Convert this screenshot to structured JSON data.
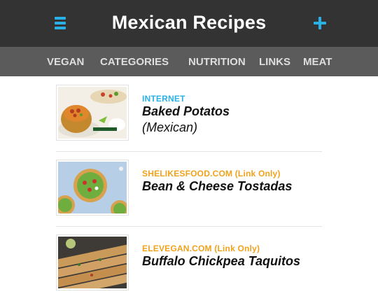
{
  "header": {
    "title": "Mexican Recipes",
    "menu_icon": "hamburger-menu-icon",
    "add_icon": "plus-icon",
    "accent": "#29b1e6"
  },
  "nav": {
    "items": [
      {
        "label": "VEGAN"
      },
      {
        "label": "CATEGORIES"
      },
      {
        "label": "NUTRITION"
      },
      {
        "label": "LINKS"
      },
      {
        "label": "MEAT"
      }
    ]
  },
  "recipes": [
    {
      "source": "INTERNET",
      "source_color": "#29b1e6",
      "title": "Baked Potatos",
      "subtitle": "(Mexican)"
    },
    {
      "source": "SHELIKESFOOD.COM (Link Only)",
      "source_color": "#f0a21b",
      "title": "Bean & Cheese Tostadas",
      "subtitle": ""
    },
    {
      "source": "ELEVEGAN.COM (Link Only)",
      "source_color": "#f0a21b",
      "title": "Buffalo Chickpea Taquitos",
      "subtitle": ""
    }
  ]
}
